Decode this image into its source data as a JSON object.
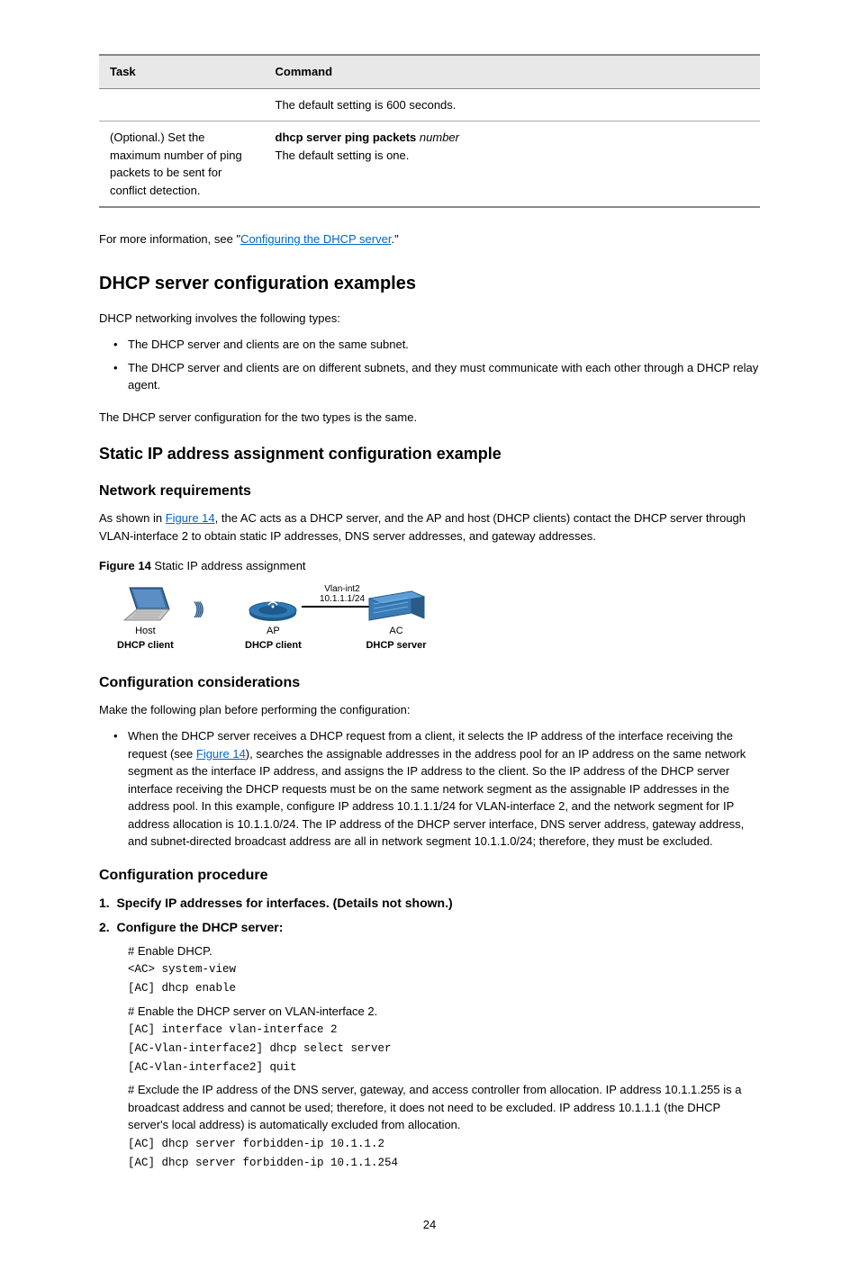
{
  "table": {
    "headers": [
      "Task",
      "Command"
    ],
    "rows": [
      [
        "",
        "The default setting is 600 seconds."
      ],
      [
        "(Optional.) Set the maximum number of ping packets to be sent for conflict detection.",
        {
          "pre": "dhcp server ping packets ",
          "arg": "number",
          "post": "\nThe default setting is one."
        }
      ]
    ]
  },
  "p1_a": "For more information, see \"",
  "p1_link": "Configuring the DHCP server",
  "p1_b": ".\"",
  "h2": "DHCP server configuration examples",
  "p2": "DHCP networking involves the following types:",
  "bullets": [
    "The DHCP server and clients are on the same subnet.",
    "The DHCP server and clients are on different subnets, and they must communicate with each other through a DHCP relay agent."
  ],
  "p3": "The DHCP server configuration for the two types is the same.",
  "h3": "Static IP address assignment configuration example",
  "h4_1": "Network requirements",
  "p4_a": "As shown in ",
  "p4_link": "Figure 14",
  "p4_b": ", the AC acts as a DHCP server, and the AP and host (DHCP clients) contact the DHCP server through VLAN-interface 2 to obtain static IP addresses, DNS server addresses, and gateway addresses.",
  "fig_num": "Figure 14",
  "fig_caption": "Static IP address assignment",
  "dev_host": "Host",
  "dev_host_sub": "DHCP client",
  "dev_ap": "AP",
  "dev_ap_sub": "DHCP client",
  "dev_ac": "AC",
  "dev_ac_sub": "DHCP server",
  "iface_label1": "Vlan-int2",
  "iface_label2": "10.1.1.1/24",
  "h4_2": "Configuration considerations",
  "p5": "Make the following plan before performing the configuration:",
  "consideration_a": "When the DHCP server receives a DHCP request from a client, it selects the IP address of the interface receiving the request (see ",
  "consideration_link": "Figure 14",
  "consideration_b": "), searches the assignable addresses in the address pool for an IP address on the same network segment as the interface IP address, and assigns the IP address to the client. So the IP address of the DHCP server interface receiving the DHCP requests must be on the same network segment as the assignable IP addresses in the address pool. In this example, configure IP address 10.1.1.1/24 for VLAN-interface 2, and the network segment for IP address allocation is 10.1.1.0/24. The IP address of the DHCP server interface, DNS server address, gateway address, and subnet-directed broadcast address are all in network segment 10.1.1.0/24; therefore, they must be excluded.",
  "h4_3": "Configuration procedure",
  "h5_a": "1.",
  "h5_b": "Specify IP addresses for interfaces. (Details not shown.)",
  "h5_c": "2.",
  "h5_d": "Configure the DHCP server:",
  "cmd_c1": "# Enable DHCP.",
  "cmd1": "<AC> system-view",
  "cmd2": "[AC] dhcp enable",
  "cmd_c2": "# Enable the DHCP server on VLAN-interface 2.",
  "cmd3": "[AC] interface vlan-interface 2",
  "cmd4": "[AC-Vlan-interface2] dhcp select server",
  "cmd5": "[AC-Vlan-interface2] quit",
  "cmd_c3_a": "# Exclude the IP address of the DNS server, gateway, and access controller from allocation. IP address 10.1.1.255 is a broadcast address and cannot be used; ",
  "cmd_c3_b": "therefore, it does not need to be excluded.",
  "cmd_c3_c": " IP address 10.1.1.1 (the DHCP server's local address) is automatically excluded from allocation.",
  "cmd6": "[AC] dhcp server forbidden-ip 10.1.1.2",
  "cmd7": "[AC] dhcp server forbidden-ip 10.1.1.254",
  "page": "24"
}
